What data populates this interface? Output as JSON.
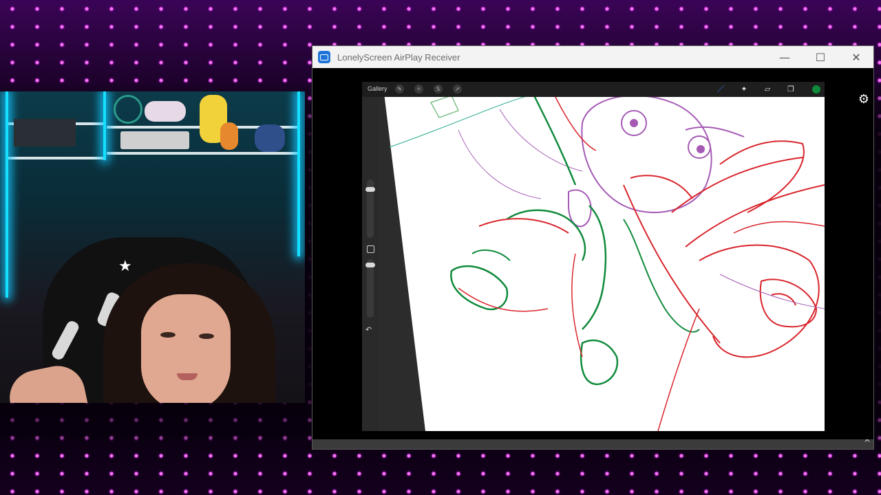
{
  "window": {
    "title": "LonelyScreen AirPlay Receiver",
    "minimize_glyph": "—",
    "maximize_glyph": "☐",
    "close_glyph": "✕",
    "settings_icon": "gear-icon",
    "settings_glyph": "⚙",
    "collapse_icon": "chevron-up-icon",
    "collapse_glyph": "^"
  },
  "procreate": {
    "gallery_label": "Gallery",
    "left_tools": [
      "wrench-icon",
      "magic-wand-icon",
      "selection-icon",
      "transform-icon"
    ],
    "left_tool_glyphs": [
      "✎",
      "✧",
      "S",
      "➚"
    ],
    "right_tools": [
      "brush-icon",
      "smudge-icon",
      "eraser-icon",
      "layers-icon"
    ],
    "right_tool_glyphs": [
      "／",
      "✦",
      "▱",
      "❐"
    ],
    "active_color": "#0e8a3a",
    "undo_glyph": "↶"
  },
  "colors": {
    "overlay_magenta": "#e04cff",
    "sketch_red": "#d8242b",
    "sketch_green": "#0f8a3b",
    "sketch_purple": "#a45ab4"
  }
}
